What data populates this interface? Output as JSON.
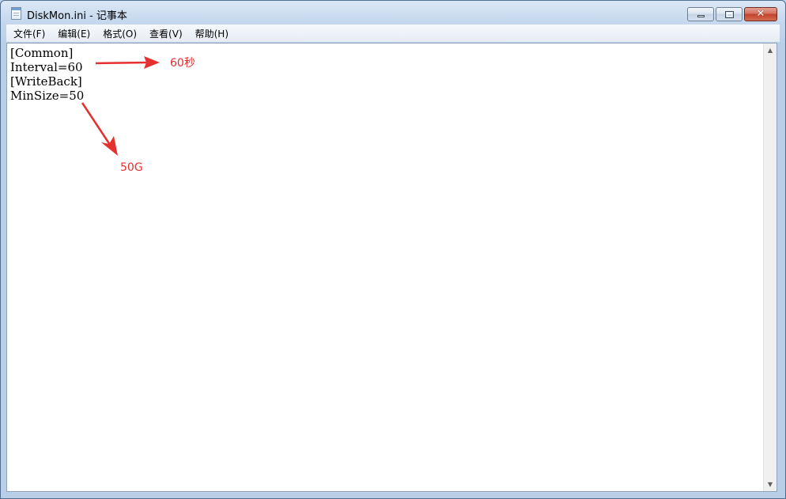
{
  "window": {
    "title": "DiskMon.ini - 记事本"
  },
  "menu": {
    "items": [
      {
        "label": "文件(F)"
      },
      {
        "label": "编辑(E)"
      },
      {
        "label": "格式(O)"
      },
      {
        "label": "查看(V)"
      },
      {
        "label": "帮助(H)"
      }
    ]
  },
  "editor": {
    "lines": [
      "[Common]",
      "Interval=60",
      "[WriteBack]",
      "MinSize=50"
    ]
  },
  "annotations": {
    "interval_note": "60秒",
    "minsize_note": "50G",
    "color": "#e53030"
  },
  "icons": {
    "app": "notepad-icon",
    "minimize": "minimize-icon",
    "maximize": "maximize-icon",
    "close": "close-icon",
    "scroll_up": "scroll-up-arrow-icon",
    "scroll_down": "scroll-down-arrow-icon"
  }
}
